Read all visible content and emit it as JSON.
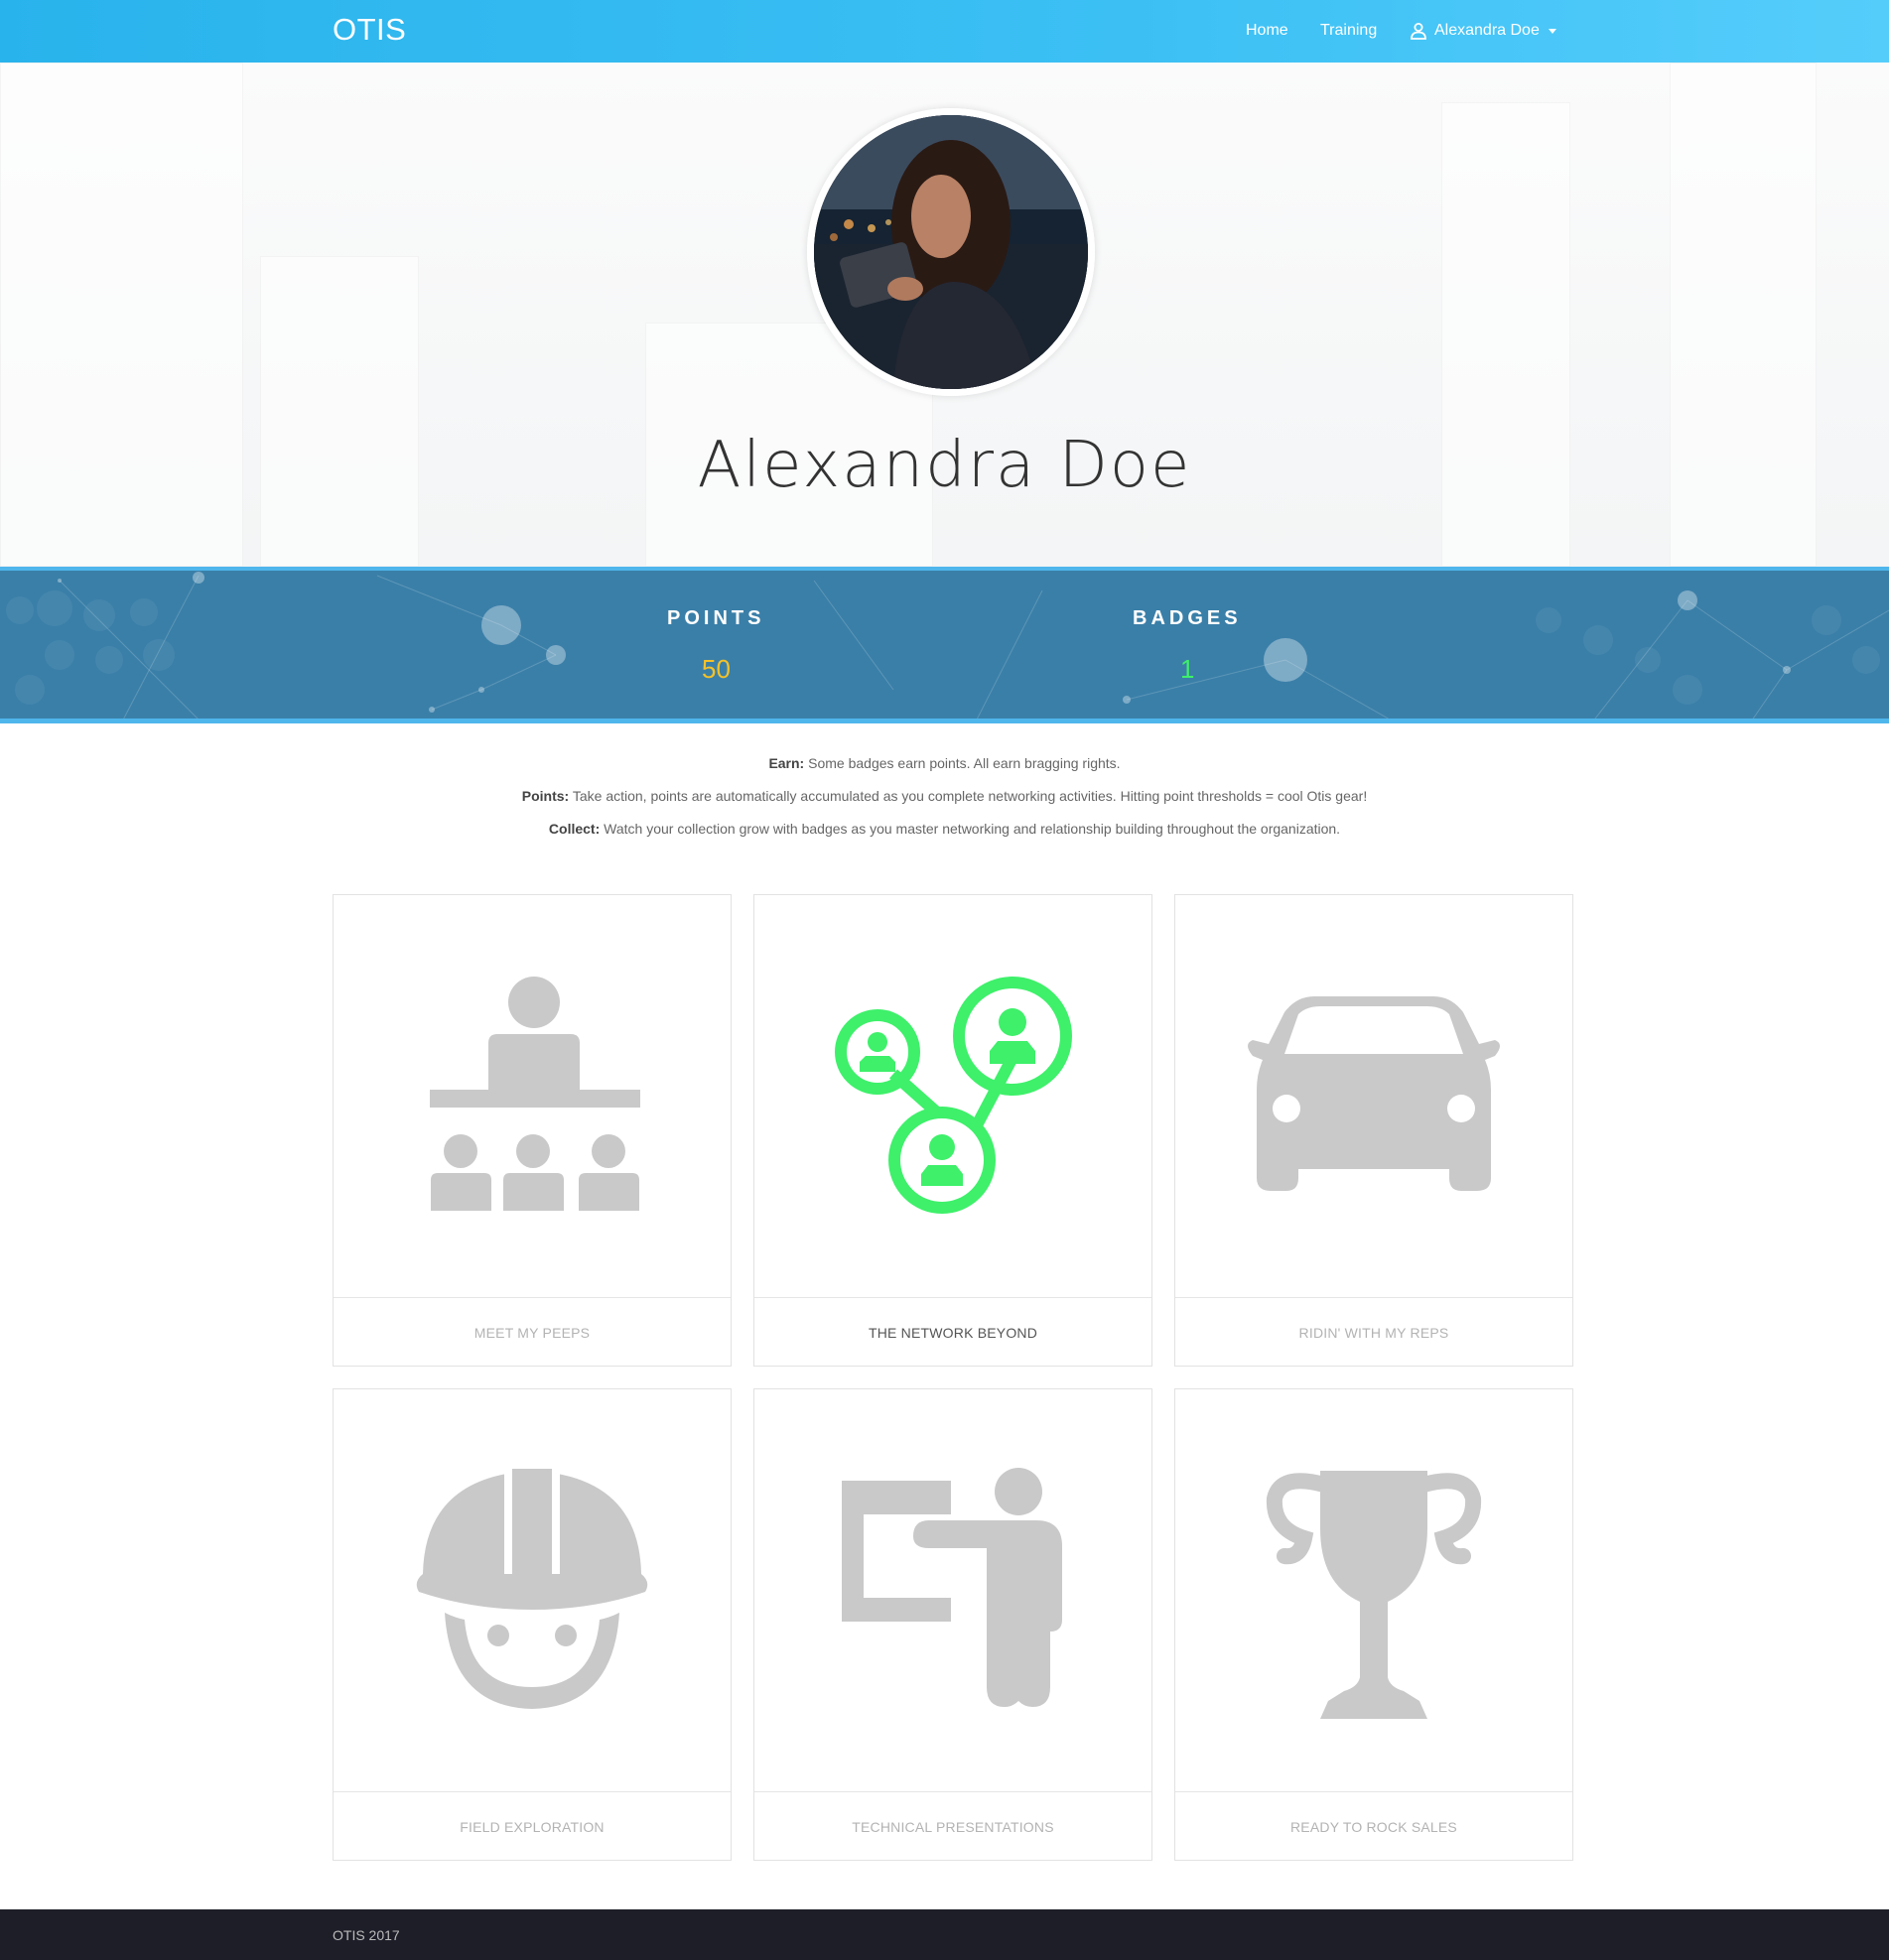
{
  "nav": {
    "brand": "OTIS",
    "home": "Home",
    "training": "Training",
    "user": "Alexandra Doe"
  },
  "profile": {
    "name": "Alexandra Doe",
    "avatar_icon": "profile-photo"
  },
  "stats": {
    "points_label": "POINTS",
    "points_value": "50",
    "badges_label": "BADGES",
    "badges_value": "1",
    "points_color": "#f5c227",
    "badges_color": "#3ef06a"
  },
  "info": {
    "earn_label": "Earn:",
    "earn_text": " Some badges earn points. All earn bragging rights.",
    "points_label": "Points:",
    "points_text": " Take action, points are automatically accumulated as you complete networking activities. Hitting point thresholds = cool Otis gear!",
    "collect_label": "Collect:",
    "collect_text": " Watch your collection grow with badges as you master networking and relationship building throughout the organization."
  },
  "badges": [
    {
      "label": "MEET MY PEEPS",
      "icon": "audience-icon",
      "earned": false
    },
    {
      "label": "THE NETWORK BEYOND",
      "icon": "network-icon",
      "earned": true
    },
    {
      "label": "RIDIN' WITH MY REPS",
      "icon": "car-icon",
      "earned": false
    },
    {
      "label": "FIELD EXPLORATION",
      "icon": "hardhat-worker-icon",
      "earned": false
    },
    {
      "label": "TECHNICAL PRESENTATIONS",
      "icon": "presenter-icon",
      "earned": false
    },
    {
      "label": "READY TO ROCK SALES",
      "icon": "trophy-icon",
      "earned": false
    }
  ],
  "colors": {
    "earned": "#3ef06a",
    "unearned": "#c9c9c9",
    "nav": "#29b3ec",
    "stats_bg": "#3a7fa8"
  },
  "footer": {
    "text": "OTIS 2017"
  }
}
